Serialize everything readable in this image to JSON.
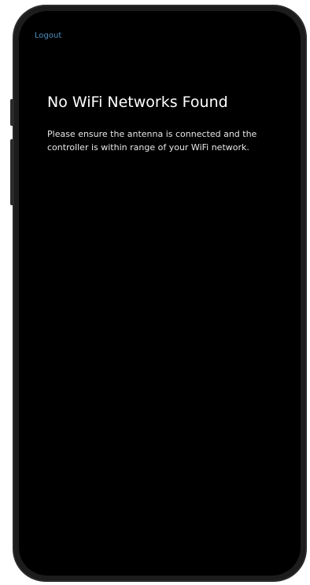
{
  "screen": {
    "logout_label": "Logout",
    "title": "No WiFi Networks Found",
    "message": "Please ensure the antenna is connected and the controller is within range of your WiFi network."
  },
  "colors": {
    "background": "#000000",
    "frame": "#1c1c1c",
    "link": "#4d8fbf",
    "text": "#ffffff"
  }
}
